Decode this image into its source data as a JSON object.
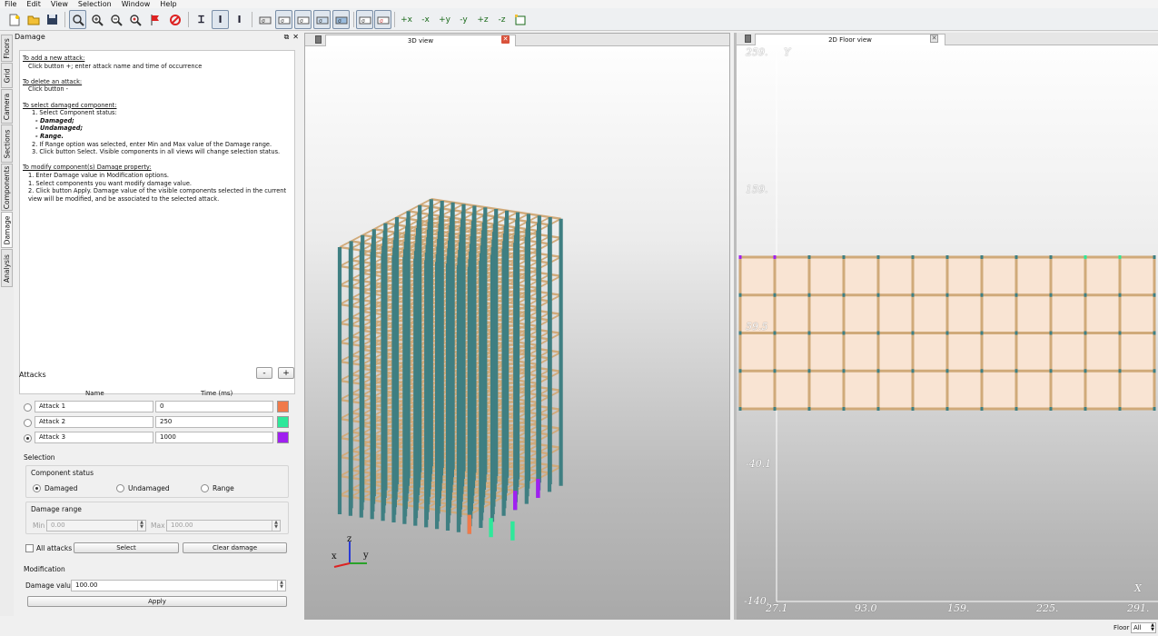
{
  "menu": [
    "File",
    "Edit",
    "View",
    "Selection",
    "Window",
    "Help"
  ],
  "toolbar_icons": [
    "new-file",
    "open-folder",
    "save",
    "zoom-fit",
    "zoom-in",
    "zoom-out",
    "zoom-region",
    "flag-red",
    "no-entry",
    "text-strike",
    "text-select",
    "text-scale",
    "component-filter",
    "view-mode-1",
    "view-mode-2",
    "view-mode-3",
    "view-mode-4",
    "view-mode-5",
    "view-mode-6",
    "axis-plus-x",
    "axis-minus-x",
    "axis-plus-y",
    "axis-minus-y",
    "axis-plus-z",
    "axis-minus-z",
    "view-box"
  ],
  "side_tabs": [
    "Floors",
    "Grid",
    "Camera",
    "Sections",
    "Components",
    "Damage",
    "Analysis"
  ],
  "dock": {
    "title": "Damage",
    "help": {
      "add_heading": "To add a new attack:",
      "add_line": "Click button  +; enter attack name and time of occurrence",
      "delete_heading": "To delete an attack:",
      "delete_line": "Click button  -",
      "select_heading": "To select damaged component:",
      "select_1": "1. Select Component status:",
      "select_1a": "- Damaged;",
      "select_1b": "- Undamaged;",
      "select_1c": "- Range.",
      "select_2": "2. If Range option was selected, enter Min and Max value of the Damage range.",
      "select_3": "3. Click button Select. Visible components in all views will change selection status.",
      "modify_heading": "To modify component(s) Damage property:",
      "modify_1": "1. Enter Damage value in Modification options.",
      "modify_2": "1. Select components you want modify damage value.",
      "modify_3": "2. Click button Apply. Damage value of the visible components selected in the current view will be modified, and be associated to the selected attack."
    },
    "attacks_label": "Attacks",
    "minus": "-",
    "plus": "+",
    "col_name": "Name",
    "col_time": "Time (ms)",
    "attacks": [
      {
        "name": "Attack 1",
        "time": "0",
        "color": "#f07a4a",
        "checked": false
      },
      {
        "name": "Attack 2",
        "time": "250",
        "color": "#2ee89a",
        "checked": false
      },
      {
        "name": "Attack 3",
        "time": "1000",
        "color": "#a020f0",
        "checked": true
      }
    ],
    "selection_label": "Selection",
    "component_status_label": "Component status",
    "status_damaged": "Damaged",
    "status_undamaged": "Undamaged",
    "status_range": "Range",
    "damage_range_label": "Damage range",
    "min_label": "Min",
    "min_value": "0.00",
    "max_label": "Max",
    "max_value": "100.00",
    "all_attacks": "All attacks",
    "select_btn": "Select",
    "clear_btn": "Clear damage",
    "modification_label": "Modification",
    "damage_value_label": "Damage value",
    "damage_value": "100.00",
    "apply_btn": "Apply"
  },
  "view3d": {
    "tab": "3D view",
    "axis_x": "x",
    "axis_y": "y",
    "axis_z": "z"
  },
  "view2d": {
    "tab": "2D Floor view",
    "y_axis": "Y",
    "x_axis": "X",
    "y_ticks": [
      "259.",
      "159.",
      "59.5",
      "-40.1",
      "-140."
    ],
    "x_ticks": [
      "27.1",
      "93.0",
      "159.",
      "225.",
      "291."
    ]
  },
  "status": {
    "floor_label": "Floor",
    "floor_value": "All"
  },
  "colors": {
    "column": "#3f7f82",
    "beam": "#d0aa7a",
    "slab": "#f9e4d3",
    "attack1": "#f07a4a",
    "attack2": "#2ee89a",
    "attack3": "#a020f0"
  }
}
